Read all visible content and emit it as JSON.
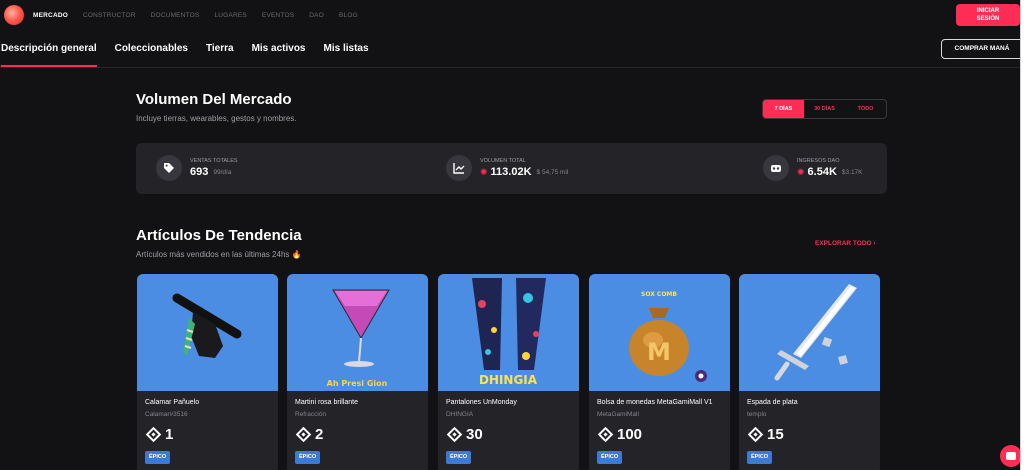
{
  "topnav": {
    "items": [
      {
        "label": "MERCADO",
        "active": true
      },
      {
        "label": "CONSTRUCTOR",
        "active": false
      },
      {
        "label": "DOCUMENTOS",
        "active": false
      },
      {
        "label": "LUGARES",
        "active": false
      },
      {
        "label": "EVENTOS",
        "active": false
      },
      {
        "label": "DAO",
        "active": false
      },
      {
        "label": "BLOG",
        "active": false
      }
    ],
    "signin_line1": "INICIAR",
    "signin_line2": "SESIÓN"
  },
  "subnav": {
    "tabs": [
      {
        "label": "Descripción general",
        "active": true
      },
      {
        "label": "Coleccionables",
        "active": false
      },
      {
        "label": "Tierra",
        "active": false
      },
      {
        "label": "Mis activos",
        "active": false
      },
      {
        "label": "Mis listas",
        "active": false
      }
    ],
    "buy_mana": "COMPRAR MANÁ"
  },
  "market": {
    "title": "Volumen Del Mercado",
    "subtitle": "Incluye tierras, wearables, gestos y nombres.",
    "ranges": [
      {
        "label": "7 DÍAS",
        "active": true
      },
      {
        "label": "30 DÍAS",
        "active": false
      },
      {
        "label": "TODO",
        "active": false
      }
    ],
    "stats": {
      "sales": {
        "label": "VENTAS TOTALES",
        "value": "693",
        "sub": "99/día"
      },
      "volume": {
        "label": "VOLUMEN TOTAL",
        "value": "113.02K",
        "sub": "$ 54,75 mil"
      },
      "revenue": {
        "label": "INGRESOS DAO",
        "value": "6.54K",
        "sub": "$3.17K"
      }
    }
  },
  "trending": {
    "title": "Artículos De Tendencia",
    "subtitle": "Artículos más vendidos en las últimas 24hs 🔥",
    "explore": "EXPLORAR TODO",
    "items": [
      {
        "title": "Calamar Pañuelo",
        "creator": "Calamar#3516",
        "price": "1",
        "rarity": "ÉPICO",
        "icon": "black-jacket-icon"
      },
      {
        "title": "Martini rosa brillante",
        "creator": "Refracción",
        "price": "2",
        "rarity": "ÉPICO",
        "icon": "martini-glass-icon"
      },
      {
        "title": "Pantalones UnMonday",
        "creator": "DHINGIA",
        "price": "30",
        "rarity": "ÉPICO",
        "icon": "pants-icon"
      },
      {
        "title": "Bolsa de monedas MetaGamiMall V1",
        "creator": "MetaGamiMall",
        "price": "100",
        "rarity": "ÉPICO",
        "icon": "money-bag-icon"
      },
      {
        "title": "Espada de plata",
        "creator": "templo",
        "price": "15",
        "rarity": "ÉPICO",
        "icon": "silver-sword-icon"
      }
    ],
    "image_texts": {
      "martini": "Ah Presi Gion",
      "pants": "DHINGIA",
      "bag": "SOX COMB",
      "bag_symbol": "M"
    }
  },
  "colors": {
    "accent": "#ff2d55",
    "background": "#121113",
    "card": "#242328",
    "item_bg": "#4b8de3",
    "rarity": "#3c7ad8"
  }
}
